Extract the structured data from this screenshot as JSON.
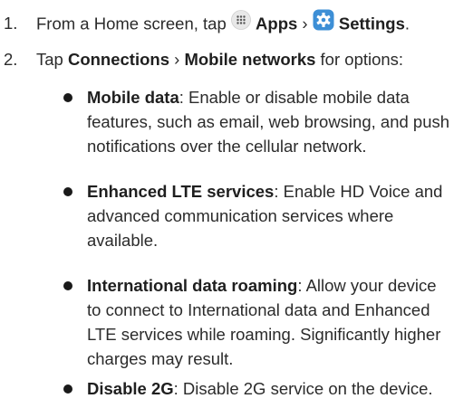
{
  "steps": [
    {
      "number": "1.",
      "prefix": "From a Home screen, tap ",
      "apps_label": "Apps",
      "separator": " › ",
      "settings_label": "Settings",
      "suffix": "."
    },
    {
      "number": "2.",
      "prefix": "Tap ",
      "connections_label": "Connections",
      "separator": " › ",
      "mobile_networks_label": "Mobile networks",
      "suffix": " for options:"
    }
  ],
  "options": [
    {
      "term": "Mobile data",
      "lines": [
        ": Enable or disable mobile data",
        "features, such as email, web browsing, and push",
        "notifications over the cellular network."
      ]
    },
    {
      "term": "Enhanced LTE services",
      "lines": [
        ": Enable HD Voice and",
        "advanced communication services where",
        "available."
      ]
    },
    {
      "term": "International data roaming",
      "lines": [
        ": Allow your device",
        "to connect to International data and Enhanced",
        "LTE services while roaming. Significantly higher",
        "charges may result."
      ]
    },
    {
      "term": "Disable 2G",
      "lines": [
        ": Disable 2G service on the device."
      ]
    }
  ],
  "icons": {
    "apps": "apps-grid-icon",
    "settings": "settings-gear-icon"
  },
  "colors": {
    "settings_icon": "#3d8fd6",
    "apps_icon_bg": "#e8e8e8"
  }
}
